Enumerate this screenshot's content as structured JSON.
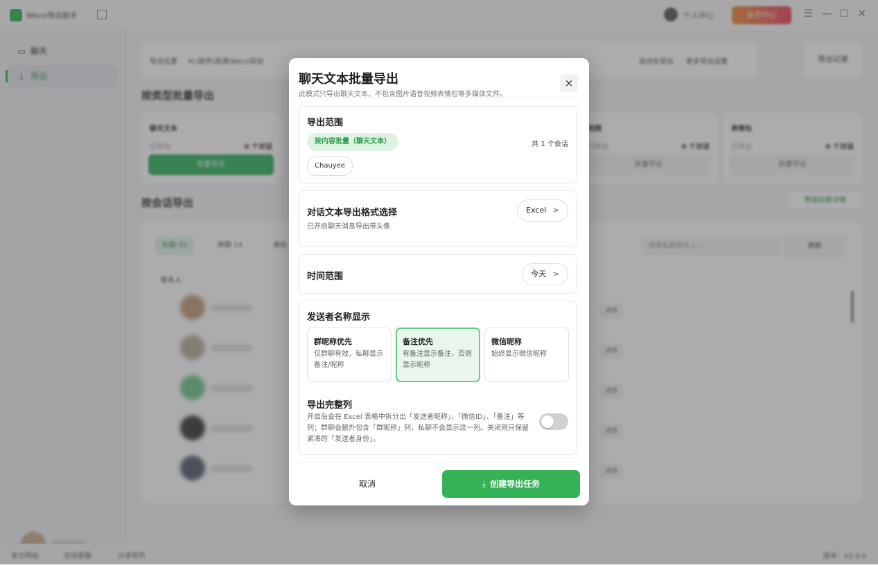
{
  "app": {
    "title": "Weco导出助手",
    "user_center": "个人中心",
    "member_center": "会员中心",
    "win_controls": [
      "☰",
      "—",
      "☐",
      "✕"
    ]
  },
  "sidebar": {
    "items": [
      {
        "label": "聊天",
        "icon": "chat-icon"
      },
      {
        "label": "导出",
        "icon": "export-icon"
      }
    ]
  },
  "footer": {
    "website": "官方网站",
    "support": "在线客服",
    "share": "分享软件",
    "version": "版本：V2.0.0"
  },
  "main": {
    "topbar": {
      "export_path_label": "导出位置",
      "export_path_value": "H:\\软件\\资源\\Weco导出",
      "auto_export": "自动化导出",
      "more_settings": "更多导出设置",
      "export_log": "导出记录"
    },
    "batch_title": "按类型批量导出",
    "cards": [
      {
        "title": "聊天文本",
        "status": "已导出",
        "count": "0 个对话",
        "button": "批量导出"
      },
      {
        "title": "视频",
        "status": "已导出",
        "count": "0 个对话",
        "button": "批量导出"
      },
      {
        "title": "表情包",
        "status": "已导出",
        "count": "0 个对话",
        "button": "批量导出"
      }
    ],
    "session_title": "按会话导出",
    "session_btn": "数据加载详情",
    "tabs": [
      "私聊 33",
      "群聊 14",
      "曾经"
    ],
    "search_placeholder": "搜索私聊联系人...",
    "refresh": "刷新",
    "col_contact": "联系人",
    "row_action": "详情"
  },
  "modal": {
    "title": "聊天文本批量导出",
    "subtitle": "此模式只导出聊天文本，不包含图片语音视频表情包等多媒体文件。",
    "close": "×",
    "scope": {
      "heading": "导出范围",
      "mode_tag": "按内容批量（聊天文本）",
      "count": "共 1 个会话",
      "session_chip": "Chauyee"
    },
    "format": {
      "heading": "对话文本导出格式选择",
      "desc": "已开启聊天消息导出带头像",
      "value": "Excel",
      "arrow": ">"
    },
    "time": {
      "heading": "时间范围",
      "value": "今天",
      "arrow": ">"
    },
    "sender": {
      "heading": "发送者名称显示",
      "options": [
        {
          "title": "群昵称优先",
          "desc": "仅群聊有效，私聊显示备注/昵称",
          "selected": false
        },
        {
          "title": "备注优先",
          "desc": "有备注显示备注，否则显示昵称",
          "selected": true
        },
        {
          "title": "微信昵称",
          "desc": "始终显示微信昵称",
          "selected": false
        }
      ],
      "full_columns_heading": "导出完整列",
      "full_columns_desc": "开启后会在 Excel 表格中拆分出「发送者昵称」、「微信ID」、「备注」等列；群聊会额外包含「群昵称」列，私聊不会显示这一列。关闭则只保留紧凑的「发送者身份」。",
      "full_columns_on": false
    },
    "cancel": "取消",
    "create": "创建导出任务",
    "create_icon": "download-icon"
  },
  "colors": {
    "accent": "#35b256",
    "selected_bg": "#e9f6ec",
    "tag_bg": "#dff3e4"
  }
}
